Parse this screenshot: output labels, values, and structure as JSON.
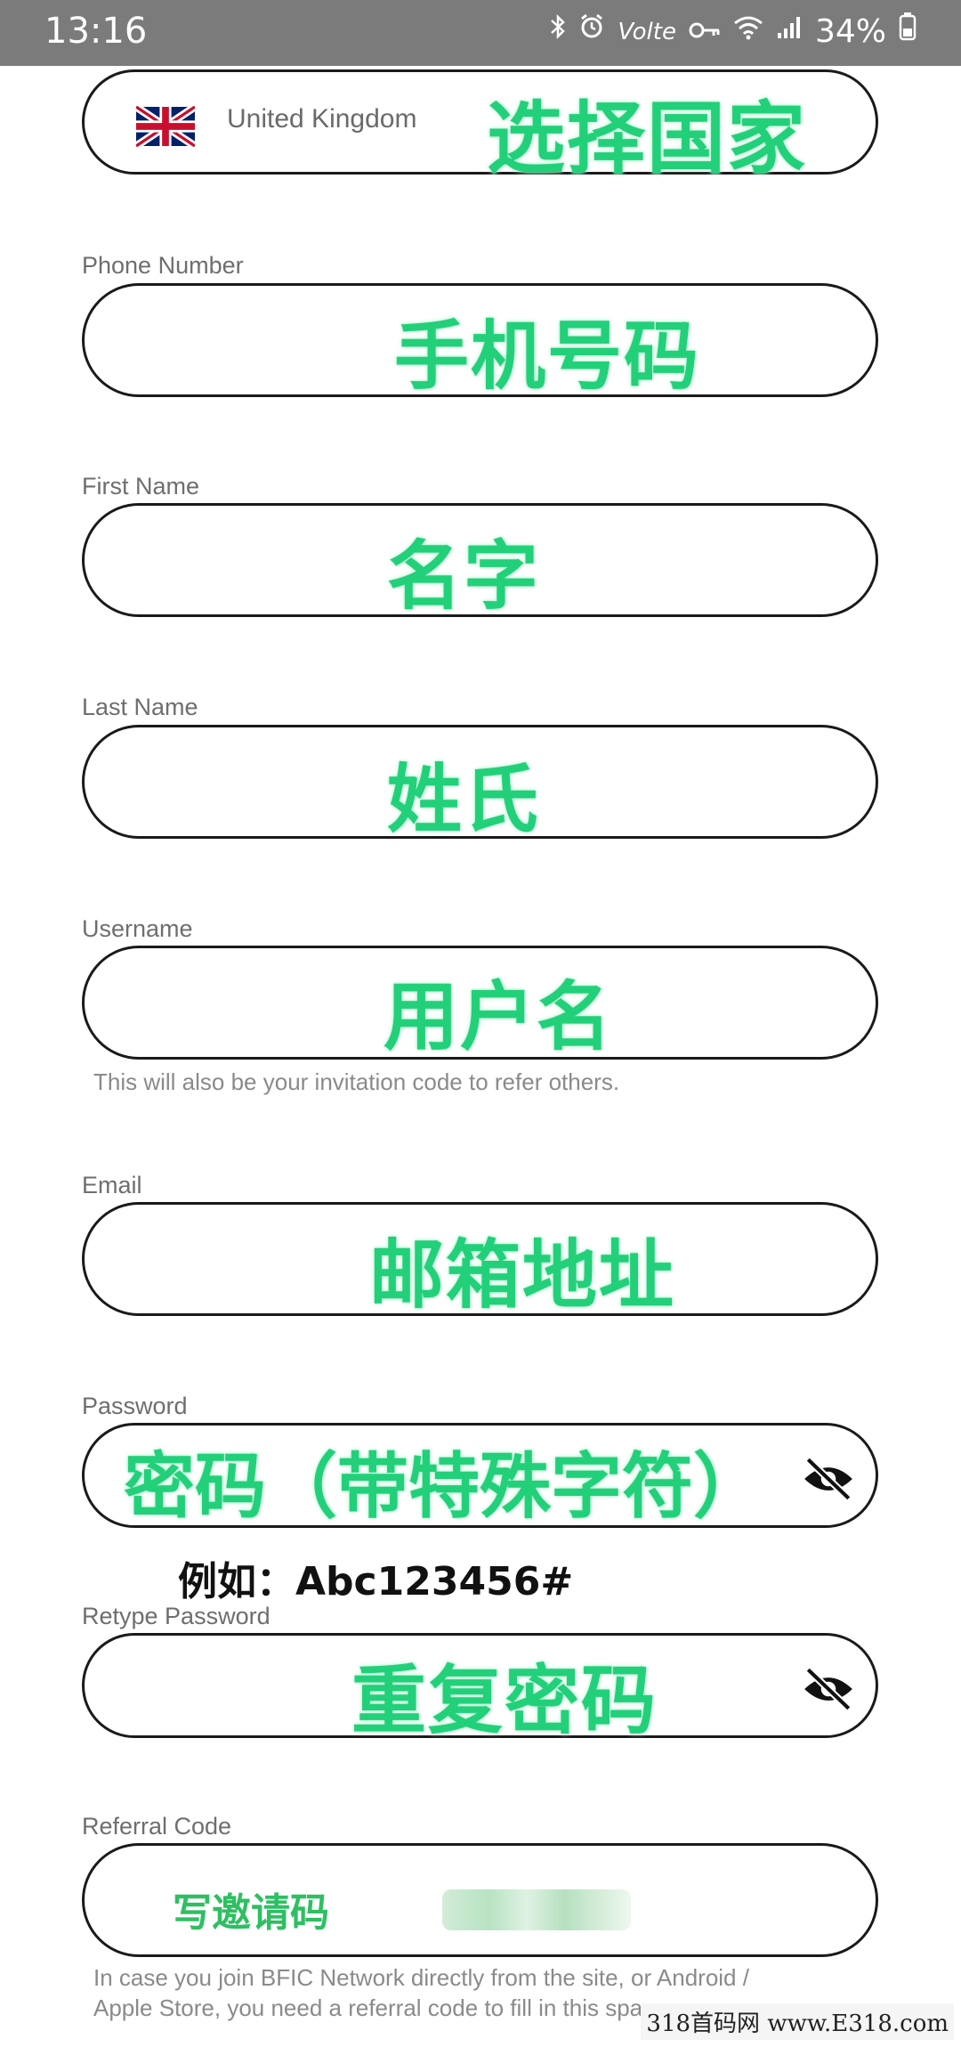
{
  "status_bar": {
    "time": "13:16",
    "volte": "Volte",
    "battery": "34%"
  },
  "country": {
    "value": "United Kingdom",
    "overlay": "选择国家"
  },
  "phone": {
    "label": "Phone Number",
    "overlay": "手机号码"
  },
  "first_name": {
    "label": "First Name",
    "overlay": "名字"
  },
  "last_name": {
    "label": "Last Name",
    "overlay": "姓氏"
  },
  "username": {
    "label": "Username",
    "overlay": "用户名",
    "helper": "This will also be your invitation code to refer others."
  },
  "email": {
    "label": "Email",
    "overlay": "邮箱地址"
  },
  "password": {
    "label": "Password",
    "overlay": "密码（带特殊字符）",
    "example": "例如：Abc123456#"
  },
  "retype_password": {
    "label": "Retype Password",
    "overlay": "重复密码"
  },
  "referral": {
    "label": "Referral Code",
    "overlay": "写邀请码",
    "helper_line1": "In case you join BFIC Network directly from the site, or Android /",
    "helper_line2": "Apple Store, you need a referral code to fill in this space."
  },
  "watermark": "318首码网  www.E318.com",
  "colors": {
    "overlay_green": "#22d07a",
    "status_bar": "#7b7b7b",
    "border": "#1a1a1a"
  }
}
